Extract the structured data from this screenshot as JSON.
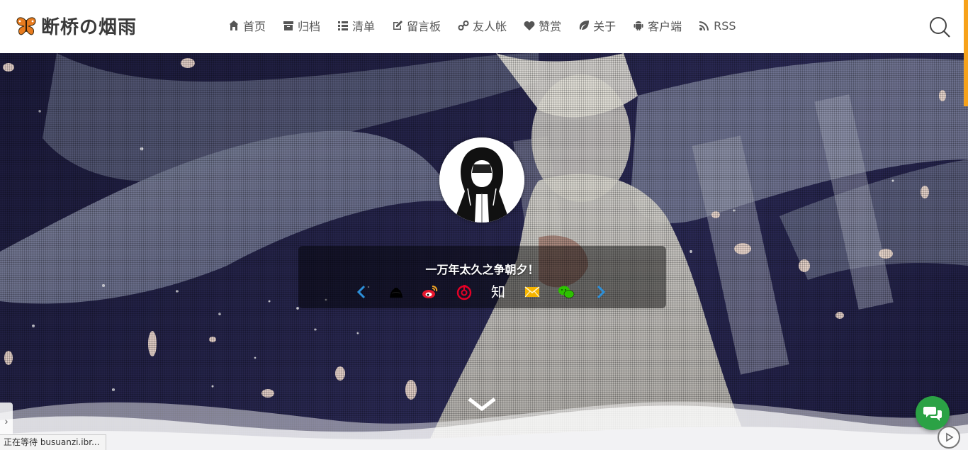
{
  "header": {
    "site_title": "断桥の烟雨",
    "logo_icon": "butterfly-icon",
    "nav": [
      {
        "label": "首页",
        "icon": "home-icon"
      },
      {
        "label": "归档",
        "icon": "archive-icon"
      },
      {
        "label": "清单",
        "icon": "list-icon"
      },
      {
        "label": "留言板",
        "icon": "edit-icon"
      },
      {
        "label": "友人帐",
        "icon": "link-icon"
      },
      {
        "label": "赞赏",
        "icon": "heart-icon"
      },
      {
        "label": "关于",
        "icon": "leaf-icon"
      },
      {
        "label": "客户端",
        "icon": "android-icon"
      },
      {
        "label": "RSS",
        "icon": "rss-icon"
      }
    ],
    "search_icon": "search-icon"
  },
  "hero": {
    "motto": "一万年太久之争朝夕！",
    "avatar_icon": "hooded-figure-avatar",
    "social": [
      {
        "name": "prev-arrow",
        "icon": "chevron-left-icon",
        "color": "#2c8fd8"
      },
      {
        "name": "github",
        "icon": "github-icon",
        "color": "#000000"
      },
      {
        "name": "weibo",
        "icon": "weibo-icon",
        "color": "#e6162d"
      },
      {
        "name": "netease-music",
        "icon": "netease-music-icon",
        "color": "#e60026"
      },
      {
        "name": "zhihu",
        "icon": "zhihu-icon",
        "text": "知",
        "color": "#ffffff"
      },
      {
        "name": "email",
        "icon": "mail-icon",
        "color": "#f5b400"
      },
      {
        "name": "wechat",
        "icon": "wechat-icon",
        "color": "#2dc100"
      },
      {
        "name": "next-arrow",
        "icon": "chevron-right-icon",
        "color": "#2c8fd8"
      }
    ],
    "scroll_down_icon": "chevron-down-icon"
  },
  "overlays": {
    "status_text": "正在等待 busuanzi.ibr...",
    "side_toggle_glyph": "›",
    "chat_icon": "chat-bubbles-icon",
    "chat_color": "#2ba245",
    "player_icon": "play-icon"
  },
  "colors": {
    "accent": "#f7a21b",
    "nav_text": "#555555",
    "title_text": "#3a3a3a"
  }
}
